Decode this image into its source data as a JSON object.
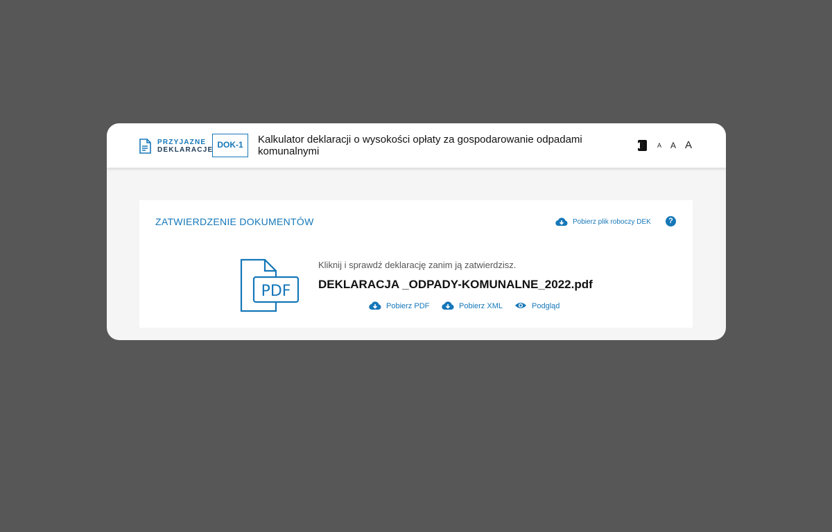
{
  "header": {
    "logo_line1": "PRZYJAZNE",
    "logo_line2": "DEKLARACJE",
    "badge": "DOK-1",
    "title": "Kalkulator deklaracji o wysokości opłaty za gospodarowanie odpadami komunalnymi",
    "font_sizes": [
      "A",
      "A",
      "A"
    ]
  },
  "panel": {
    "title": "ZATWIERDZENIE DOKUMENTÓW",
    "draft_download_label": "Pobierz plik roboczy DEK",
    "help_label": "?",
    "instruction": "Kliknij i sprawdź deklarację zanim ją zatwierdzisz.",
    "filename": "DEKLARACJA _ODPADY-KOMUNALNE_2022.pdf",
    "pdf_icon_label": "PDF",
    "actions": {
      "download_pdf": "Pobierz PDF",
      "download_xml": "Pobierz XML",
      "preview": "Podgląd"
    }
  },
  "colors": {
    "accent": "#1577b8",
    "backdrop": "#575757",
    "card_bg": "#f5f5f5"
  },
  "icons": {
    "logo": "document-pen-icon",
    "contrast": "contrast-icon",
    "download": "cloud-download-icon",
    "preview": "eye-icon",
    "help": "question-circle-icon",
    "file": "pdf-file-icon"
  }
}
